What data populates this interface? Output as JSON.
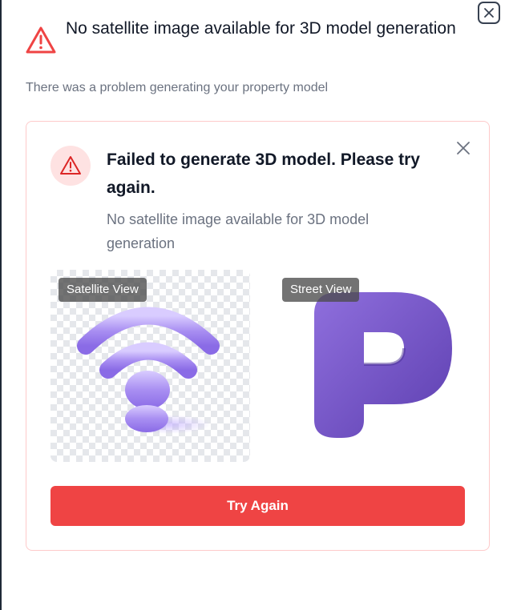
{
  "dialog": {
    "title": "No satellite image available for 3D model generation",
    "description": "There was a problem generating your property model",
    "close_icon": "close-x-icon"
  },
  "error_card": {
    "title": "Failed to generate 3D model. Please try again.",
    "message": "No satellite image available for 3D model generation",
    "alert_icon": "warning-triangle-icon",
    "close_icon": "close-x-icon"
  },
  "images": {
    "satellite": {
      "label": "Satellite View",
      "icon": "wifi-signal-icon"
    },
    "street": {
      "label": "Street View",
      "icon": "letter-p-icon"
    }
  },
  "actions": {
    "retry_label": "Try Again"
  },
  "colors": {
    "danger": "#ef4444",
    "danger_soft": "#fee2e2",
    "border": "#fecaca",
    "accent_purple": "#7c5cc9"
  }
}
